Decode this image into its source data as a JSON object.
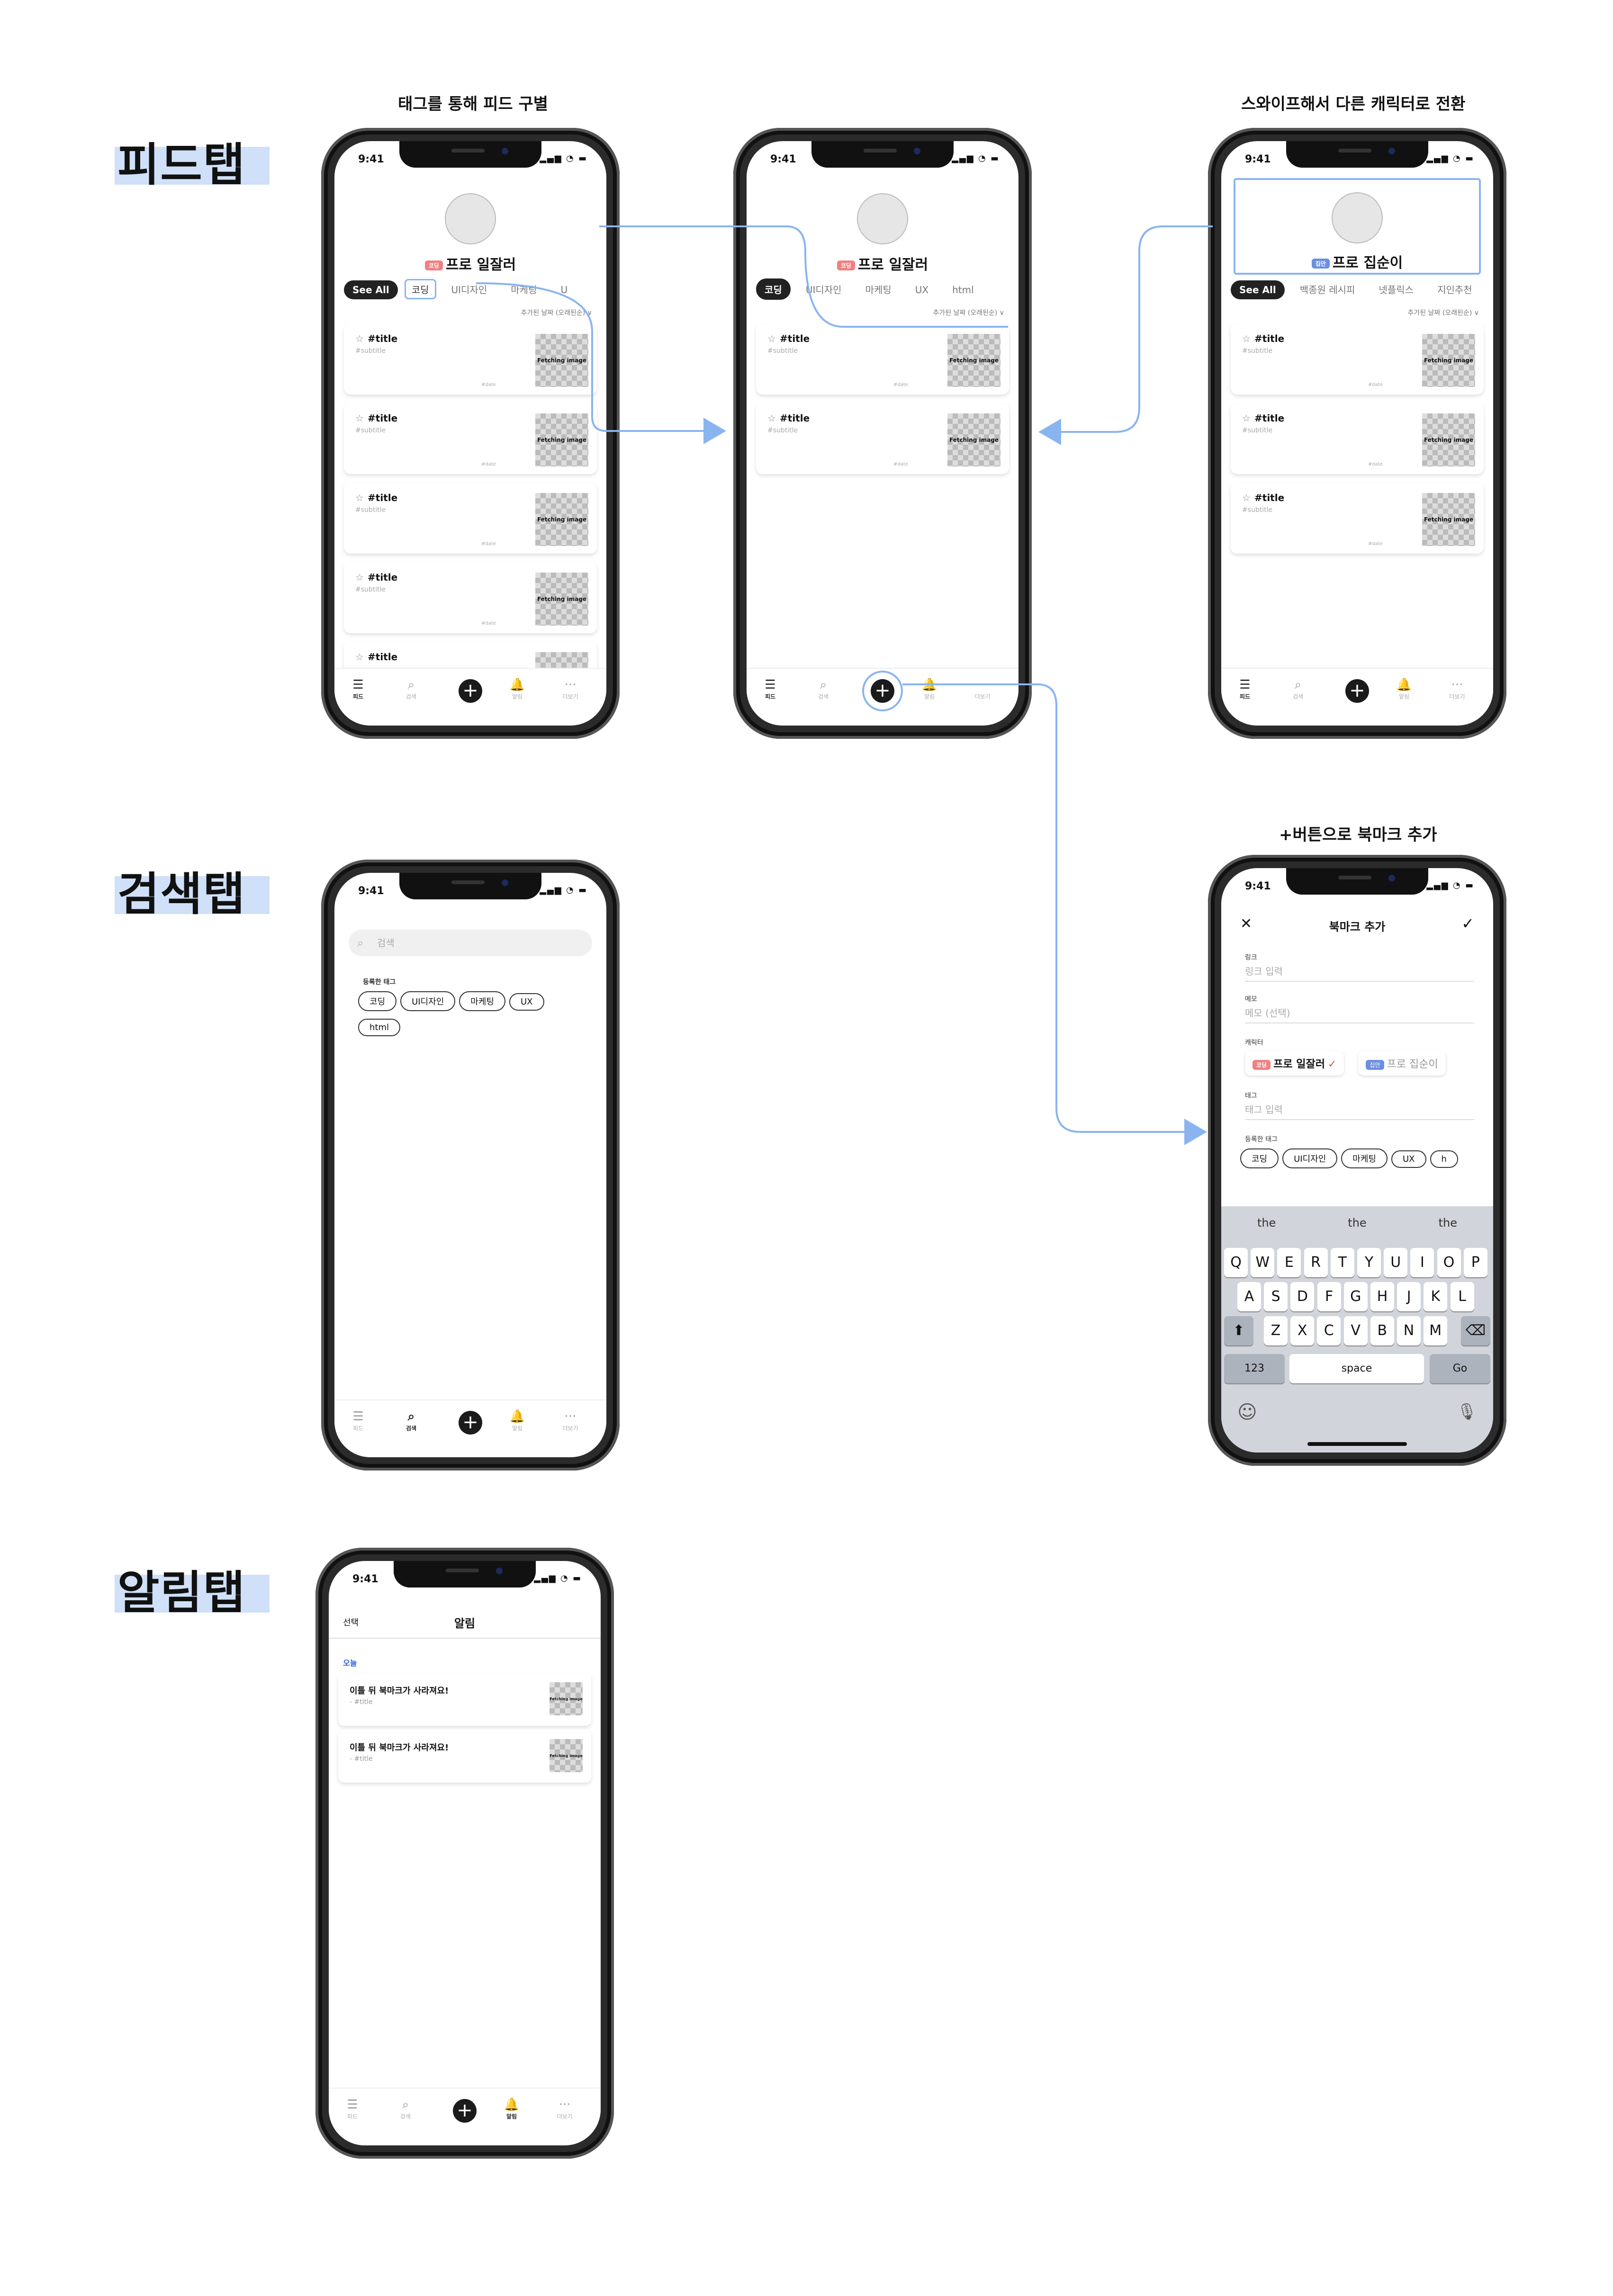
{
  "sections": {
    "feed": "피드탭",
    "search": "검색탭",
    "notif": "알림탭"
  },
  "captions": {
    "c1": "태그를 통해 피드 구별",
    "c2": "스와이프해서 다른 캐릭터로 전환",
    "c3": "+버튼으로 북마크 추가"
  },
  "status": {
    "time": "9:41",
    "icons": "▂▄▆ ◔ ▬"
  },
  "tabbar": {
    "feed": "피드",
    "search": "검색",
    "plus": "+",
    "notif": "알림",
    "more": "더보기",
    "feed_icon": "list-icon",
    "search_icon": "search-icon",
    "notif_icon": "bell-icon",
    "more_icon": "more-icon"
  },
  "phone1": {
    "badge": "코딩",
    "name": "프로 일잘러",
    "tabs": [
      "See All",
      "코딩",
      "UI디자인",
      "마케팅",
      "U"
    ],
    "sort": "추가된 날짜 (오래된순) ∨",
    "cards": [
      {
        "title": "#title",
        "sub": "#subtitle",
        "date": "#date",
        "thumb": "Fetching image"
      },
      {
        "title": "#title",
        "sub": "#subtitle",
        "date": "#date",
        "thumb": "Fetching image"
      },
      {
        "title": "#title",
        "sub": "#subtitle",
        "date": "#date",
        "thumb": "Fetching image"
      },
      {
        "title": "#title",
        "sub": "#subtitle",
        "date": "#date",
        "thumb": "Fetching image"
      },
      {
        "title": "#title",
        "sub": "",
        "date": "",
        "thumb": ""
      }
    ]
  },
  "phone2": {
    "badge": "코딩",
    "name": "프로 일잘러",
    "tabs": [
      "코딩",
      "UI디자인",
      "마케팅",
      "UX",
      "html"
    ],
    "sort": "추가된 날짜 (오래된순) ∨",
    "cards": [
      {
        "title": "#title",
        "sub": "#subtitle",
        "date": "#date",
        "thumb": "Fetching image"
      },
      {
        "title": "#title",
        "sub": "#subtitle",
        "date": "#date",
        "thumb": "Fetching image"
      }
    ]
  },
  "phone3": {
    "badge": "집안",
    "name": "프로 집순이",
    "tabs": [
      "See All",
      "백종원 레시피",
      "넷플릭스",
      "지인추천"
    ],
    "sort": "추가된 날짜 (오래된순) ∨",
    "cards": [
      {
        "title": "#title",
        "sub": "#subtitle",
        "date": "#date",
        "thumb": "Fetching image"
      },
      {
        "title": "#title",
        "sub": "#subtitle",
        "date": "#date",
        "thumb": "Fetching image"
      },
      {
        "title": "#title",
        "sub": "#subtitle",
        "date": "#date",
        "thumb": "Fetching image"
      }
    ]
  },
  "phone4": {
    "search_placeholder": "검색",
    "tags_label": "등록한 태그",
    "tags": [
      "코딩",
      "UI디자인",
      "마케팅",
      "UX",
      "html"
    ]
  },
  "phone5": {
    "title": "북마크 추가",
    "close": "✕",
    "confirm": "✓",
    "link_label": "링크",
    "link_placeholder": "링크 입력",
    "memo_label": "메모",
    "memo_placeholder": "메모 (선택)",
    "char_label": "캐릭터",
    "char1_badge": "코딩",
    "char1": "프로 일잘러",
    "char1_check": "✓",
    "char2_badge": "집안",
    "char2": "프로 집순이",
    "tag_label": "태그",
    "tag_placeholder": "태그 입력",
    "tags_label": "등록한 태그",
    "tags": [
      "코딩",
      "UI디자인",
      "마케팅",
      "UX",
      "h"
    ],
    "keyboard": {
      "suggestions": [
        "the",
        "the",
        "the"
      ],
      "row1": [
        "Q",
        "W",
        "E",
        "R",
        "T",
        "Y",
        "U",
        "I",
        "O",
        "P"
      ],
      "row2": [
        "A",
        "S",
        "D",
        "F",
        "G",
        "H",
        "J",
        "K",
        "L"
      ],
      "row3": [
        "Z",
        "X",
        "C",
        "V",
        "B",
        "N",
        "M"
      ],
      "shift": "⬆",
      "delete": "⌫",
      "num": "123",
      "space": "space",
      "go": "Go",
      "emoji": "☺",
      "mic": "🎙"
    }
  },
  "phone6": {
    "select": "선택",
    "title": "알림",
    "section": "오늘",
    "items": [
      {
        "text": "이틀 뒤 북마크가 사라져요!",
        "sub": "- #title",
        "thumb": "Fetching image"
      },
      {
        "text": "이틀 뒤 북마크가 사라져요!",
        "sub": "- #title",
        "thumb": "Fetching image"
      }
    ]
  },
  "colors": {
    "accent": "#8ab4f0",
    "highlight": "#cfe0f8",
    "badge_red": "#f08080",
    "badge_blue": "#6b8fe0"
  }
}
